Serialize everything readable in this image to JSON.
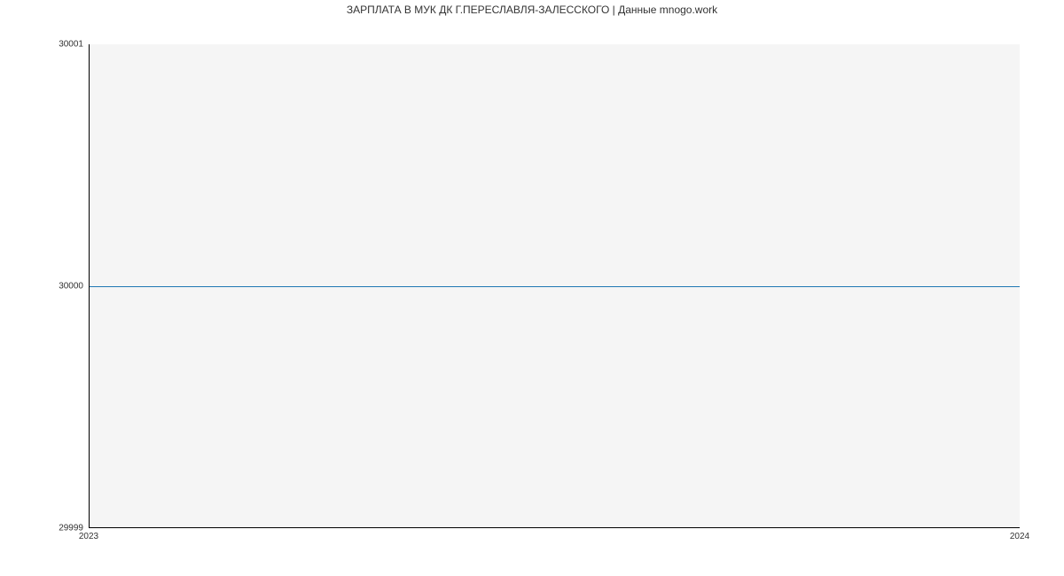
{
  "chart_data": {
    "type": "line",
    "title": "ЗАРПЛАТА В МУК ДК Г.ПЕРЕСЛАВЛЯ-ЗАЛЕССКОГО | Данные mnogo.work",
    "x": [
      2023,
      2024
    ],
    "values": [
      30000,
      30000
    ],
    "xlabel": "",
    "ylabel": "",
    "x_ticks": [
      "2023",
      "2024"
    ],
    "y_ticks": [
      "29999",
      "30000",
      "30001"
    ],
    "xlim": [
      2023,
      2024
    ],
    "ylim": [
      29999,
      30001
    ],
    "line_color": "#1f77b4"
  }
}
